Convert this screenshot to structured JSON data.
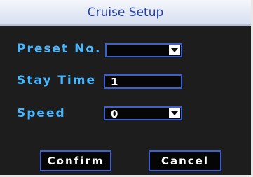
{
  "dialog": {
    "title": "Cruise Setup"
  },
  "form": {
    "preset": {
      "label": "Preset No.",
      "value": "",
      "dropdown_icon": "chevron-down-icon"
    },
    "stay_time": {
      "label": "Stay Time",
      "value": "1"
    },
    "speed": {
      "label": "Speed",
      "value": "0",
      "dropdown_icon": "chevron-down-icon"
    }
  },
  "buttons": {
    "confirm": "Confirm",
    "cancel": "Cancel"
  },
  "colors": {
    "label": "#47b7ff",
    "title": "#2441a8",
    "border": "#3b61d0",
    "background": "#1d1d1d"
  }
}
